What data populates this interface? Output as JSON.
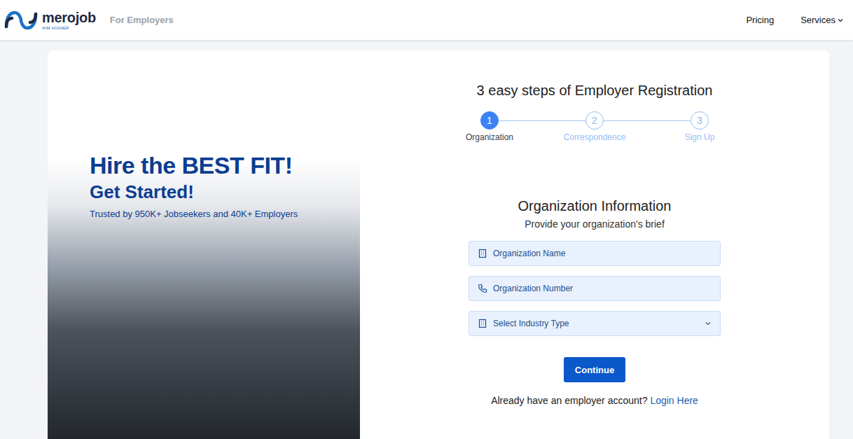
{
  "header": {
    "logo": {
      "name": "merojob",
      "tagline": "AIM HIGHER"
    },
    "section": "For Employers",
    "nav": [
      {
        "label": "Pricing",
        "kind": "link"
      },
      {
        "label": "Services",
        "kind": "menu"
      }
    ]
  },
  "hero": {
    "title": "Hire the BEST FIT!",
    "subtitle": "Get Started!",
    "trust": "Trusted by 950K+ Jobseekers and 40K+ Employers"
  },
  "registration": {
    "title": "3 easy steps of Employer Registration",
    "steps": [
      {
        "number": "1",
        "label": "Organization",
        "selected": true
      },
      {
        "number": "2",
        "label": "Correspondence",
        "selected": false
      },
      {
        "number": "3",
        "label": "Sign Up",
        "selected": false
      }
    ],
    "form": {
      "title": "Organization Information",
      "subtitle": "Provide your organization's brief",
      "fields": [
        {
          "kind": "text",
          "placeholder": "Organization Name"
        },
        {
          "kind": "phone",
          "placeholder": "Organization Number"
        },
        {
          "kind": "select",
          "placeholder": "Select Industry Type"
        }
      ],
      "submit": "Continue"
    },
    "login": {
      "prompt": "Already have an employer account?",
      "link": "Login Here"
    }
  }
}
